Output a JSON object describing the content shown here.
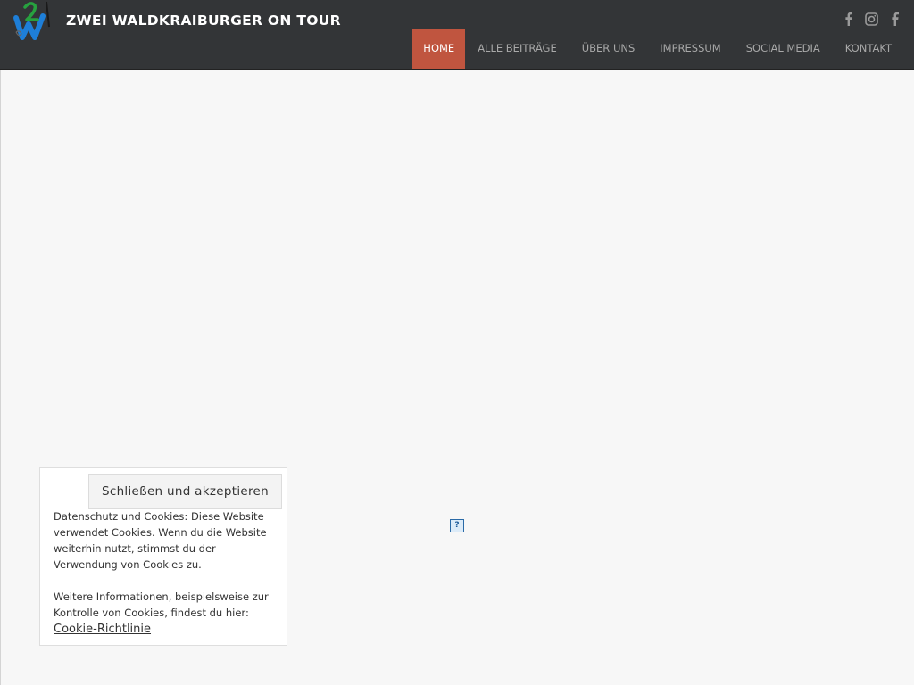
{
  "site": {
    "title": "ZWEI WALDKRAIBURGER ON TOUR"
  },
  "social": {
    "icons": [
      "facebook-icon",
      "instagram-icon",
      "facebook-icon"
    ]
  },
  "nav": {
    "items": [
      {
        "label": "HOME",
        "active": true
      },
      {
        "label": "ALLE BEITRÄGE",
        "active": false
      },
      {
        "label": "ÜBER UNS",
        "active": false
      },
      {
        "label": "IMPRESSUM",
        "active": false
      },
      {
        "label": "SOCIAL MEDIA",
        "active": false
      },
      {
        "label": "KONTAKT",
        "active": false
      }
    ]
  },
  "cookie": {
    "button_label": "Schließen und akzeptieren",
    "text1": "Datenschutz und Cookies: Diese Website verwendet Cookies. Wenn du die Website weiterhin nutzt, stimmst du der Verwendung von Cookies zu.",
    "text2": "Weitere Informationen, beispielsweise zur Kontrolle von Cookies, findest du hier:",
    "link_label": "Cookie-Richtlinie"
  },
  "placeholder": {
    "glyph": "?"
  },
  "colors": {
    "header_bg": "#333537",
    "accent": "#c0553f",
    "page_bg": "#f7f7f7"
  }
}
